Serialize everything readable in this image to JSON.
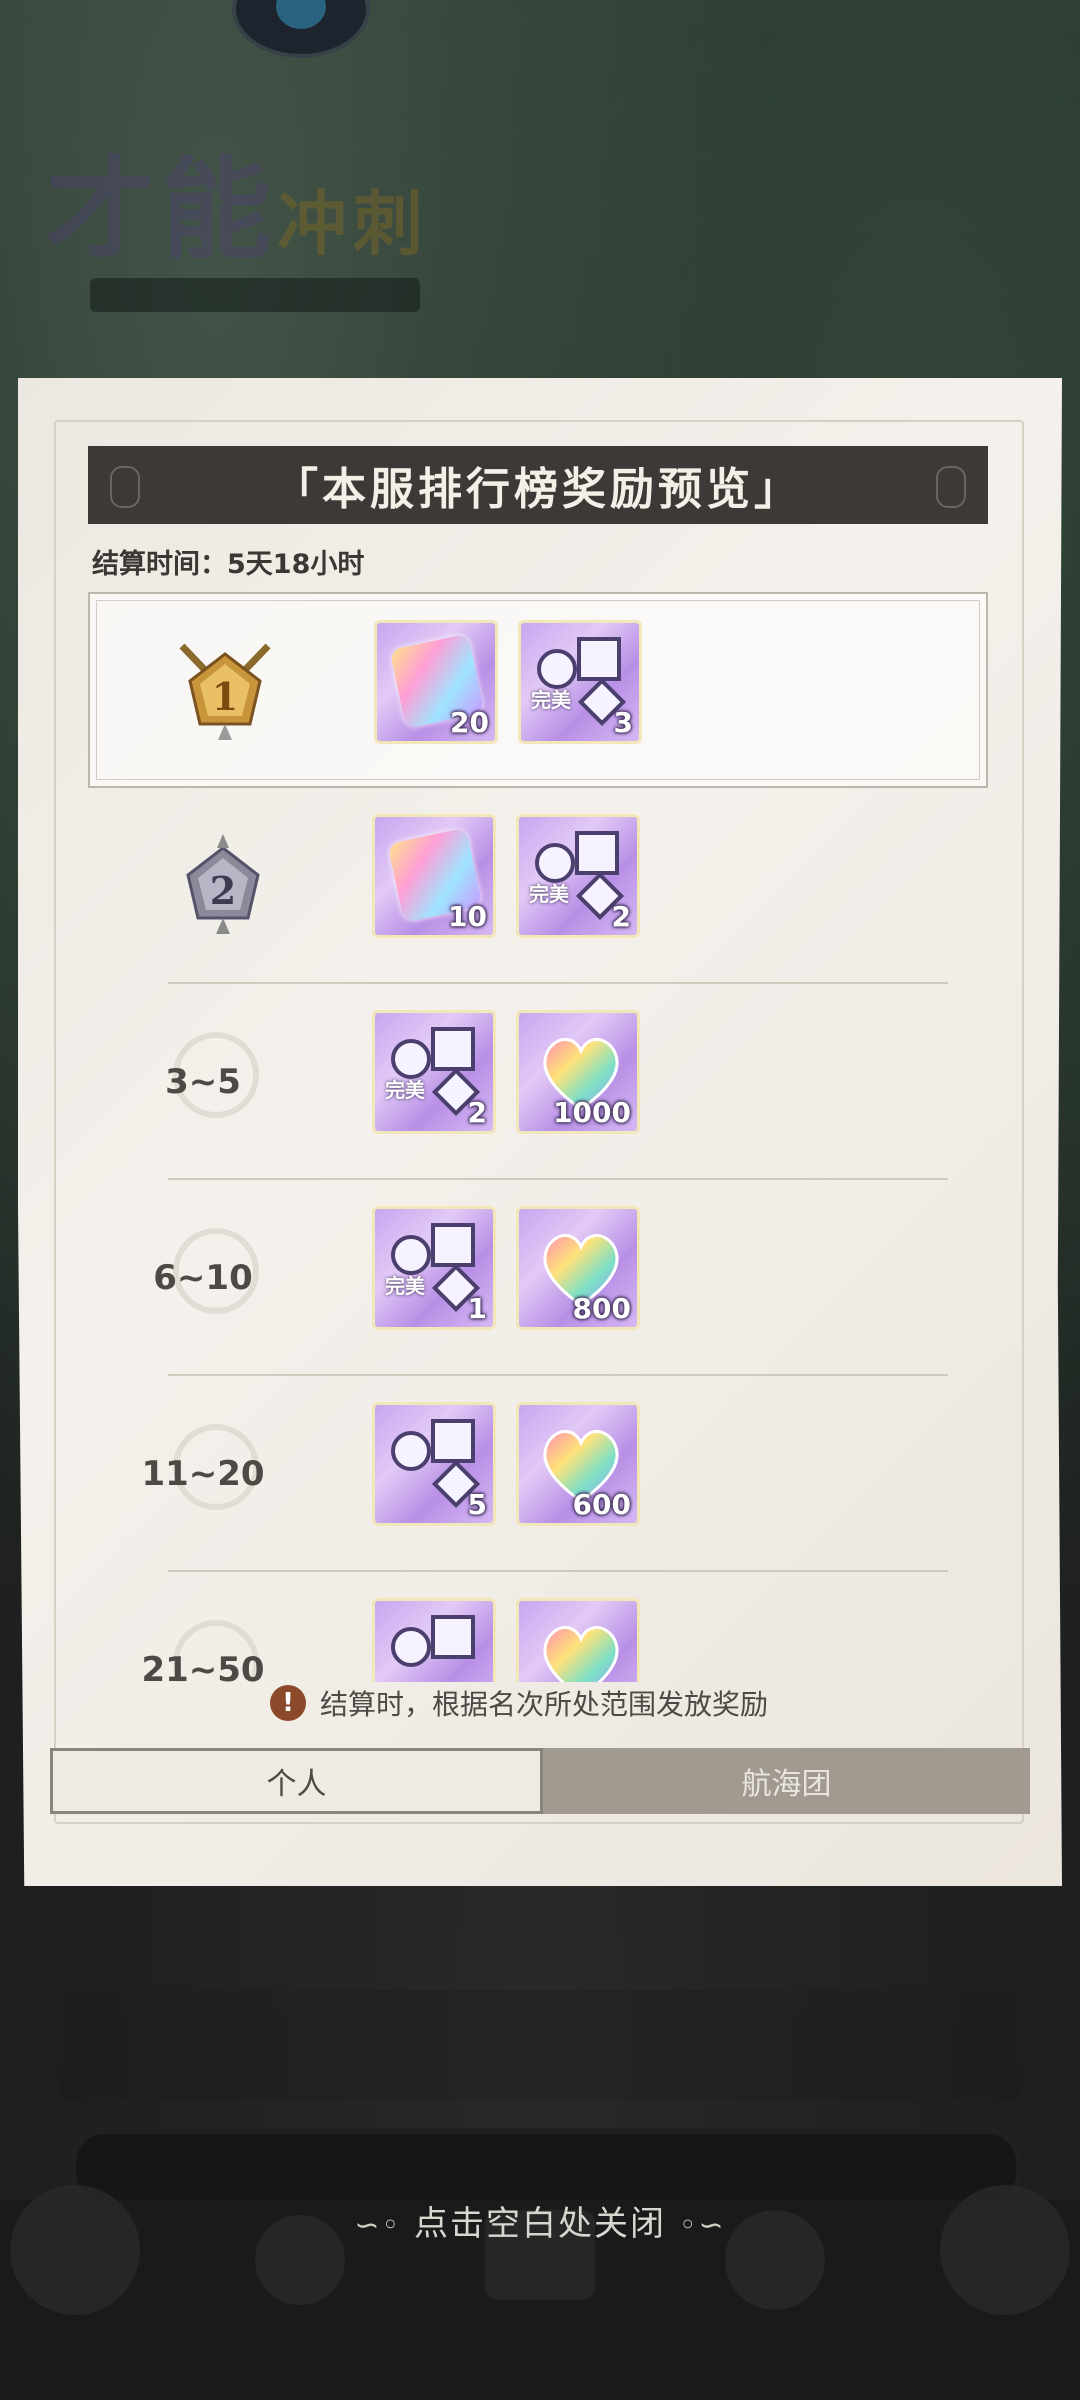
{
  "background": {
    "title_main": "才能",
    "title_sub": "冲刺"
  },
  "panel": {
    "title": "「本服排行榜奖励预览」",
    "settle_label": "结算时间：",
    "settle_value": "5天18小时"
  },
  "rows": [
    {
      "rank": "1",
      "items": [
        {
          "icon": "rainbow-puzzle-icon",
          "qty": "20"
        },
        {
          "icon": "perfect-badge-icon",
          "label": "完美",
          "qty": "3"
        }
      ]
    },
    {
      "rank": "2",
      "items": [
        {
          "icon": "rainbow-puzzle-icon",
          "qty": "10"
        },
        {
          "icon": "perfect-badge-icon",
          "label": "完美",
          "qty": "2"
        }
      ]
    },
    {
      "rank": "3~5",
      "items": [
        {
          "icon": "perfect-badge-icon",
          "label": "完美",
          "qty": "2"
        },
        {
          "icon": "rainbow-heart-gem-icon",
          "qty": "1000"
        }
      ]
    },
    {
      "rank": "6~10",
      "items": [
        {
          "icon": "perfect-badge-icon",
          "label": "完美",
          "qty": "1"
        },
        {
          "icon": "rainbow-heart-gem-icon",
          "qty": "800"
        }
      ]
    },
    {
      "rank": "11~20",
      "items": [
        {
          "icon": "badge-icon",
          "qty": "5"
        },
        {
          "icon": "rainbow-heart-gem-icon",
          "qty": "600"
        }
      ]
    },
    {
      "rank": "21~50",
      "items": [
        {
          "icon": "badge-icon",
          "qty": ""
        },
        {
          "icon": "rainbow-heart-gem-icon",
          "qty": ""
        }
      ]
    }
  ],
  "notice": {
    "icon": "exclamation-icon",
    "text": "结算时，根据名次所处范围发放奖励"
  },
  "tabs": [
    {
      "label": "个人",
      "active": true
    },
    {
      "label": "航海团",
      "active": false
    }
  ],
  "close_hint": "点击空白处关闭",
  "colors": {
    "title_bar": "#3d3936",
    "paper": "#f1ede7",
    "item_bg": "#c7a7f0",
    "active_tab": "#efebe4",
    "inactive_tab": "#a19a90"
  }
}
